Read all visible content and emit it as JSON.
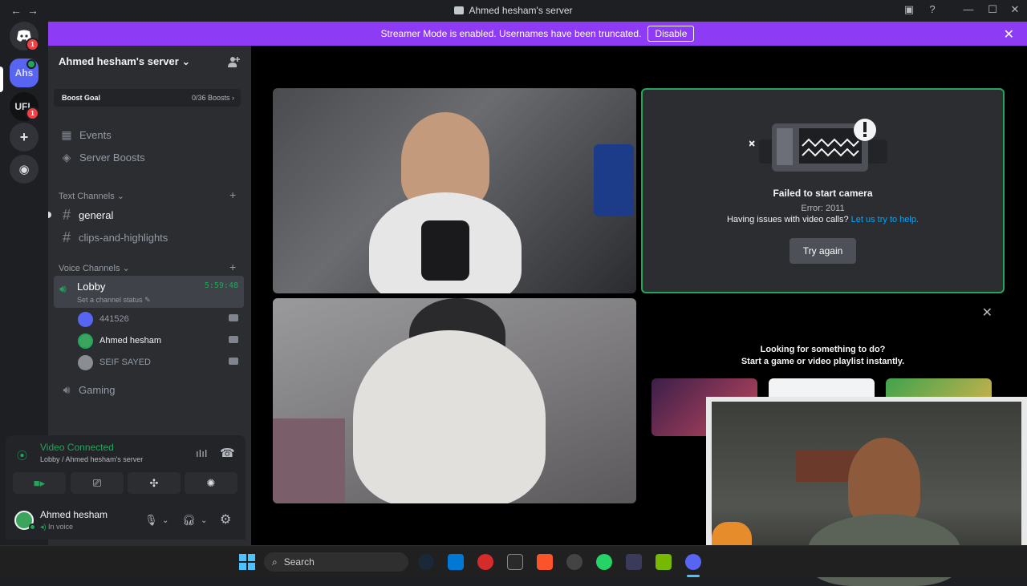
{
  "titlebar": {
    "title": "Ahmed hesham's server",
    "back": "←",
    "forward": "→"
  },
  "rail": {
    "servers": [
      {
        "label": "Ahs",
        "color": "#5865f2"
      },
      {
        "label": "UFL",
        "color": "#111214"
      }
    ],
    "home_badge": "1",
    "ufl_badge": "1"
  },
  "banner": {
    "text": "Streamer Mode is enabled. Usernames have been truncated.",
    "button": "Disable"
  },
  "sidebar": {
    "server_name": "Ahmed hesham's server",
    "boost_goal": {
      "label": "Boost Goal",
      "value": "0/36 Boosts"
    },
    "nav": [
      {
        "label": "Events"
      },
      {
        "label": "Server Boosts"
      }
    ],
    "text_category": "Text Channels",
    "text_channels": [
      {
        "label": "general"
      },
      {
        "label": "clips-and-highlights"
      }
    ],
    "voice_category": "Voice Channels",
    "lobby": {
      "label": "Lobby",
      "status": "Set a channel status",
      "time": "5:59:48"
    },
    "voice_users": [
      {
        "name": "441526",
        "color": "#5865f2"
      },
      {
        "name": "Ahmed hesham",
        "color": "#3ba55d"
      },
      {
        "name": "SEIF SAYED",
        "color": "#8a8d91"
      }
    ],
    "gaming": "Gaming"
  },
  "voice_panel": {
    "status": "Video Connected",
    "sub": "Lobby / Ahmed hesham's server"
  },
  "user_panel": {
    "name": "Ahmed hesham",
    "sub": "In voice"
  },
  "stage": {
    "cam_fail_title": "Failed to start camera",
    "cam_fail_error": "Error: 2011",
    "cam_fail_help": "Having issues with video calls?",
    "cam_fail_link": "Let us try to help.",
    "try_again": "Try again",
    "activity_line1": "Looking for something to do?",
    "activity_line2": "Start a game or video playlist instantly."
  },
  "taskbar": {
    "search": "Search"
  }
}
